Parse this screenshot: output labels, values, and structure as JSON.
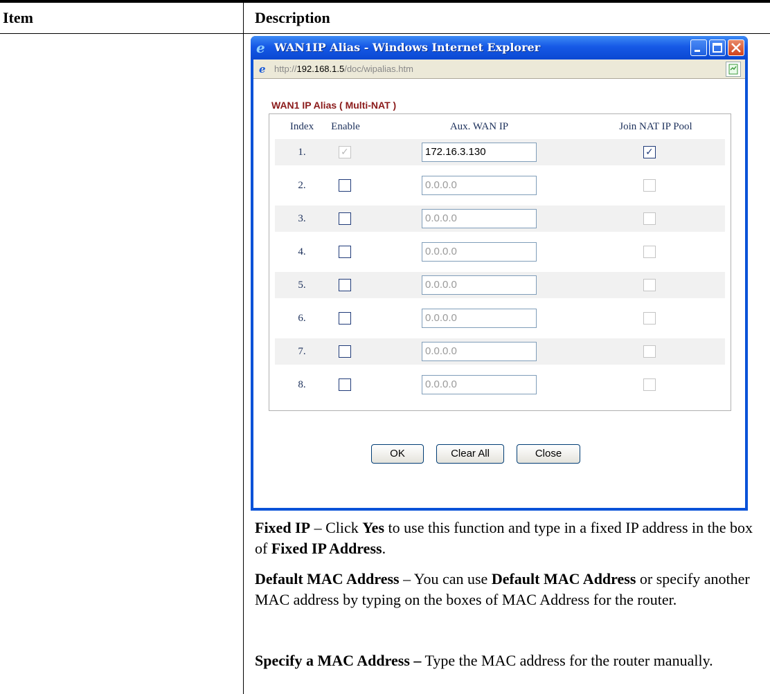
{
  "table": {
    "col_item": "Item",
    "col_description": "Description"
  },
  "window": {
    "title": "WAN1IP Alias - Windows Internet Explorer",
    "url_prefix": "http://",
    "url_host": "192.168.1.5",
    "url_path": "/doc/wipalias.htm",
    "icons": [
      "ie-logo-icon",
      "minimize-icon",
      "maximize-icon",
      "close-icon",
      "page-icon",
      "certificate-icon"
    ]
  },
  "dialog": {
    "title": "WAN1 IP Alias ( Multi-NAT )",
    "headers": {
      "index": "Index",
      "enable": "Enable",
      "aux_ip": "Aux. WAN IP",
      "join_pool": "Join NAT IP Pool"
    },
    "rows": [
      {
        "index": "1.",
        "enable": true,
        "enable_disabled": true,
        "ip": "172.16.3.130",
        "join_pool": true,
        "join_disabled": false
      },
      {
        "index": "2.",
        "enable": false,
        "enable_disabled": false,
        "ip": "0.0.0.0",
        "join_pool": false,
        "join_disabled": true
      },
      {
        "index": "3.",
        "enable": false,
        "enable_disabled": false,
        "ip": "0.0.0.0",
        "join_pool": false,
        "join_disabled": true
      },
      {
        "index": "4.",
        "enable": false,
        "enable_disabled": false,
        "ip": "0.0.0.0",
        "join_pool": false,
        "join_disabled": true
      },
      {
        "index": "5.",
        "enable": false,
        "enable_disabled": false,
        "ip": "0.0.0.0",
        "join_pool": false,
        "join_disabled": true
      },
      {
        "index": "6.",
        "enable": false,
        "enable_disabled": false,
        "ip": "0.0.0.0",
        "join_pool": false,
        "join_disabled": true
      },
      {
        "index": "7.",
        "enable": false,
        "enable_disabled": false,
        "ip": "0.0.0.0",
        "join_pool": false,
        "join_disabled": true
      },
      {
        "index": "8.",
        "enable": false,
        "enable_disabled": false,
        "ip": "0.0.0.0",
        "join_pool": false,
        "join_disabled": true
      }
    ],
    "buttons": {
      "ok": "OK",
      "clear_all": "Clear All",
      "close": "Close"
    }
  },
  "description": {
    "fixed_ip": {
      "term": "Fixed IP",
      "t1": " – Click ",
      "b1": "Yes",
      "t2": " to use this function and type in a fixed IP address in the box of ",
      "b2": "Fixed IP Address",
      "t3": "."
    },
    "default_mac": {
      "term": "Default MAC Address",
      "t1": " – You can use ",
      "b1": "Default MAC Address",
      "t2": " or specify another MAC address by typing on the boxes of MAC Address for the router."
    },
    "specify_mac": {
      "term": "Specify a MAC Address –",
      "t1": " Type the MAC address for the router manually."
    }
  }
}
